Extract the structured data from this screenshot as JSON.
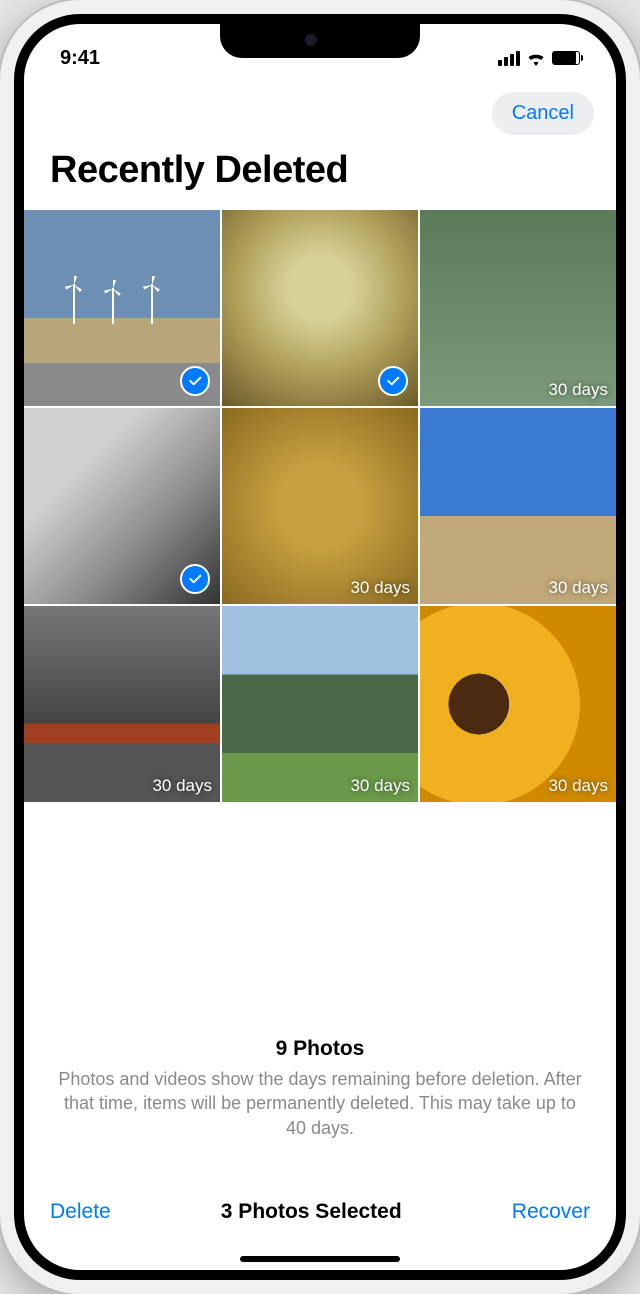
{
  "status": {
    "time": "9:41"
  },
  "nav": {
    "cancel": "Cancel"
  },
  "title": "Recently Deleted",
  "photos": [
    {
      "selected": true,
      "days": ""
    },
    {
      "selected": true,
      "days": ""
    },
    {
      "selected": false,
      "days": "30 days"
    },
    {
      "selected": true,
      "days": ""
    },
    {
      "selected": false,
      "days": "30 days"
    },
    {
      "selected": false,
      "days": "30 days"
    },
    {
      "selected": false,
      "days": "30 days"
    },
    {
      "selected": false,
      "days": "30 days"
    },
    {
      "selected": false,
      "days": "30 days"
    }
  ],
  "footer": {
    "count": "9 Photos",
    "description": "Photos and videos show the days remaining before deletion. After that time, items will be permanently deleted. This may take up to 40 days."
  },
  "toolbar": {
    "delete": "Delete",
    "selected": "3 Photos Selected",
    "recover": "Recover"
  }
}
